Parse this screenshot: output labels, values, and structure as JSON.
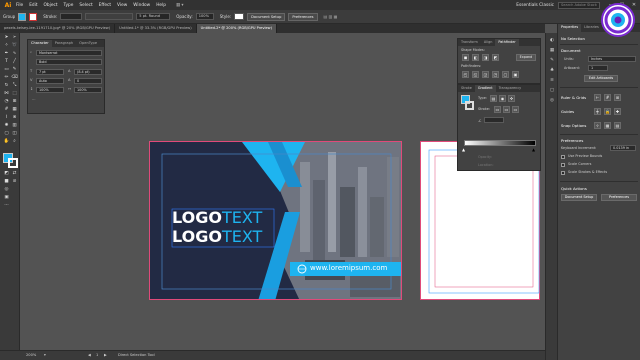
{
  "app": {
    "logo": "Ai",
    "menu": [
      "File",
      "Edit",
      "Object",
      "Type",
      "Select",
      "Effect",
      "View",
      "Window",
      "Help"
    ],
    "workspace": "Essentials Classic",
    "search_placeholder": "Search Adobe Stock"
  },
  "controlbar": {
    "selection_label": "Group",
    "stroke_label": "Stroke:",
    "stroke_value": "",
    "style_label": "5 pt. Round",
    "opacity_label": "Opacity:",
    "opacity_value": "100%",
    "style_field_label": "Style:",
    "doc_setup": "Document Setup",
    "preferences": "Preferences"
  },
  "tabs": [
    {
      "label": "pexels-kelsey-lee-1191710.jpg* @ 20% (RGB/GPU Preview)",
      "active": false
    },
    {
      "label": "Untitled-1* @ 33.3% (RGB/GPU Preview)",
      "active": false
    },
    {
      "label": "Untitled-2* @ 200% (RGB/GPU Preview)",
      "active": true
    }
  ],
  "character_panel": {
    "tabs": [
      "Character",
      "Paragraph",
      "OpenType"
    ],
    "font_family": "Montserrat",
    "font_style": "Bold",
    "font_size": "7 pt",
    "leading": "(8.4 pt)",
    "kerning": "Auto",
    "tracking": "0",
    "vscale": "100%",
    "hscale": "100%"
  },
  "artboard": {
    "logo_line1_bold": "LOGO",
    "logo_line1_thin": "TEXT",
    "logo_line2_bold": "LOGO",
    "logo_line2_thin": "TEXT",
    "website": "www.loremipsum.com",
    "colors": {
      "navy": "#222a44",
      "cyan": "#1eb4f0",
      "dark_blue": "#1a2340"
    }
  },
  "pathfinder_panel": {
    "tabs": [
      "Transform",
      "Align",
      "Pathfinder"
    ],
    "shape_modes_label": "Shape Modes:",
    "pathfinders_label": "Pathfinders:",
    "expand_label": "Expand"
  },
  "gradient_panel": {
    "tabs": [
      "Stroke",
      "Gradient",
      "Transparency"
    ],
    "type_label": "Type:",
    "stroke_label": "Stroke:",
    "opacity_label": "Opacity:",
    "location_label": "Location:"
  },
  "properties": {
    "tabs": [
      "Properties",
      "Libraries"
    ],
    "no_selection": "No Selection",
    "document_label": "Document",
    "units_label": "Units:",
    "units_value": "Inches",
    "artboard_label": "Artboard:",
    "artboard_value": "1",
    "edit_artboards": "Edit Artboards",
    "rulers_grids": "Ruler & Grids",
    "guides": "Guides",
    "snap_options": "Snap Options",
    "preferences_label": "Preferences",
    "keyboard_increment_label": "Keyboard Increment:",
    "keyboard_increment_value": "0.0139 in",
    "use_preview_bounds": "Use Preview Bounds",
    "scale_corners": "Scale Corners",
    "scale_strokes": "Scale Strokes & Effects",
    "quick_actions": "Quick Actions",
    "doc_setup_btn": "Document Setup",
    "preferences_btn": "Preferences"
  },
  "status": {
    "zoom": "200%",
    "artboard_num": "1",
    "mode": "Direct Selection Tool"
  }
}
